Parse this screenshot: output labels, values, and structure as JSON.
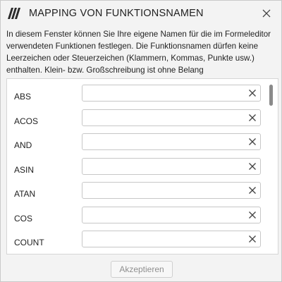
{
  "dialog": {
    "title": "MAPPING VON FUNKTIONSNAMEN",
    "description": "In diesem Fenster können Sie Ihre eigene Namen für die im Formeleditor verwendeten Funktionen festlegen. Die Funktionsnamen dürfen keine Leerzeichen oder Steuerzeichen (Klammern, Kommas, Punkte usw.) enthalten. Klein- bzw. Großschreibung ist ohne Belang",
    "icons": {
      "app": "app-logo-icon",
      "close": "close-icon",
      "clear": "clear-icon"
    }
  },
  "functions": [
    {
      "name": "ABS",
      "value": ""
    },
    {
      "name": "ACOS",
      "value": ""
    },
    {
      "name": "AND",
      "value": ""
    },
    {
      "name": "ASIN",
      "value": ""
    },
    {
      "name": "ATAN",
      "value": ""
    },
    {
      "name": "COS",
      "value": ""
    },
    {
      "name": "COUNT",
      "value": ""
    }
  ],
  "footer": {
    "accept_label": "Akzeptieren"
  },
  "colors": {
    "background": "#f3f3f3",
    "panel": "#ffffff",
    "border": "#d6d6d6",
    "disabled_text": "#8f8f8f"
  }
}
